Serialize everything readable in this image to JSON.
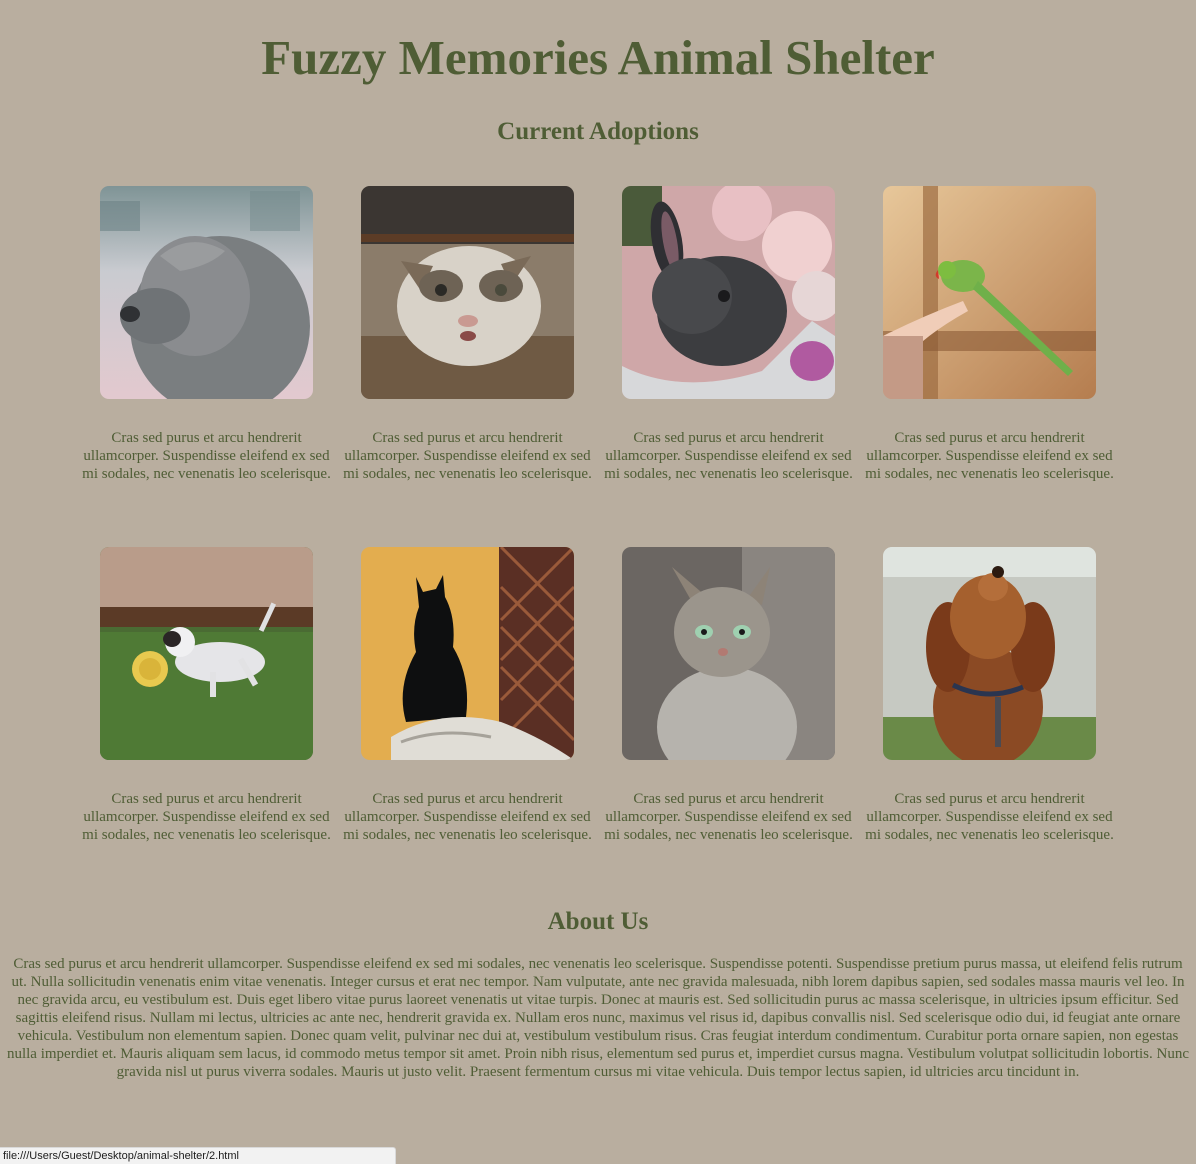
{
  "page": {
    "title": "Fuzzy Memories Animal Shelter",
    "adoptions_heading": "Current Adoptions",
    "about_heading": "About Us",
    "about_text": "Cras sed purus et arcu hendrerit ullamcorper. Suspendisse eleifend ex sed mi sodales, nec venenatis leo scelerisque. Suspendisse potenti. Suspendisse pretium purus massa, ut eleifend felis rutrum ut. Nulla sollicitudin venenatis enim vitae venenatis. Integer cursus et erat nec tempor. Nam vulputate, ante nec gravida malesuada, nibh lorem dapibus sapien, sed sodales massa mauris vel leo. In nec gravida arcu, eu vestibulum est. Duis eget libero vitae purus laoreet venenatis ut vitae turpis. Donec at mauris est. Sed sollicitudin purus ac massa scelerisque, in ultricies ipsum efficitur. Sed sagittis eleifend risus. Nullam mi lectus, ultricies ac ante nec, hendrerit gravida ex. Nullam eros nunc, maximus vel risus id, dapibus convallis nisl. Sed scelerisque odio dui, id feugiat ante ornare vehicula. Vestibulum non elementum sapien. Donec quam velit, pulvinar nec dui at, vestibulum vestibulum risus. Cras feugiat interdum condimentum. Curabitur porta ornare sapien, non egestas nulla imperdiet et. Mauris aliquam sem lacus, id commodo metus tempor sit amet. Proin nibh risus, elementum sed purus et, imperdiet cursus magna. Vestibulum volutpat sollicitudin lobortis. Nunc gravida nisl ut purus viverra sodales. Mauris ut justo velit. Praesent fermentum cursus mi vitae vehicula. Duis tempor lectus sapien, id ultricies arcu tincidunt in."
  },
  "animals": [
    {
      "photo": "grey-fluffy-dog-photo",
      "caption": "Cras sed purus et arcu hendrerit ullamcorper. Suspendisse eleifend ex sed mi sodales, nec venenatis leo scelerisque."
    },
    {
      "photo": "tabby-white-cat-photo",
      "caption": "Cras sed purus et arcu hendrerit ullamcorper. Suspendisse eleifend ex sed mi sodales, nec venenatis leo scelerisque."
    },
    {
      "photo": "grey-rabbit-photo",
      "caption": "Cras sed purus et arcu hendrerit ullamcorper. Suspendisse eleifend ex sed mi sodales, nec venenatis leo scelerisque."
    },
    {
      "photo": "green-parrot-photo",
      "caption": "Cras sed purus et arcu hendrerit ullamcorper. Suspendisse eleifend ex sed mi sodales, nec venenatis leo scelerisque."
    },
    {
      "photo": "dog-with-frisbee-photo",
      "caption": "Cras sed purus et arcu hendrerit ullamcorper. Suspendisse eleifend ex sed mi sodales, nec venenatis leo scelerisque."
    },
    {
      "photo": "black-cat-photo",
      "caption": "Cras sed purus et arcu hendrerit ullamcorper. Suspendisse eleifend ex sed mi sodales, nec venenatis leo scelerisque."
    },
    {
      "photo": "grey-tabby-cat-photo",
      "caption": "Cras sed purus et arcu hendrerit ullamcorper. Suspendisse eleifend ex sed mi sodales, nec venenatis leo scelerisque."
    },
    {
      "photo": "spaniel-dog-photo",
      "caption": "Cras sed purus et arcu hendrerit ullamcorper. Suspendisse eleifend ex sed mi sodales, nec venenatis leo scelerisque."
    }
  ],
  "statusbar": {
    "url": "file:///Users/Guest/Desktop/animal-shelter/2.html"
  },
  "colors": {
    "background": "#b9ae9f",
    "text": "#4f5d35"
  }
}
